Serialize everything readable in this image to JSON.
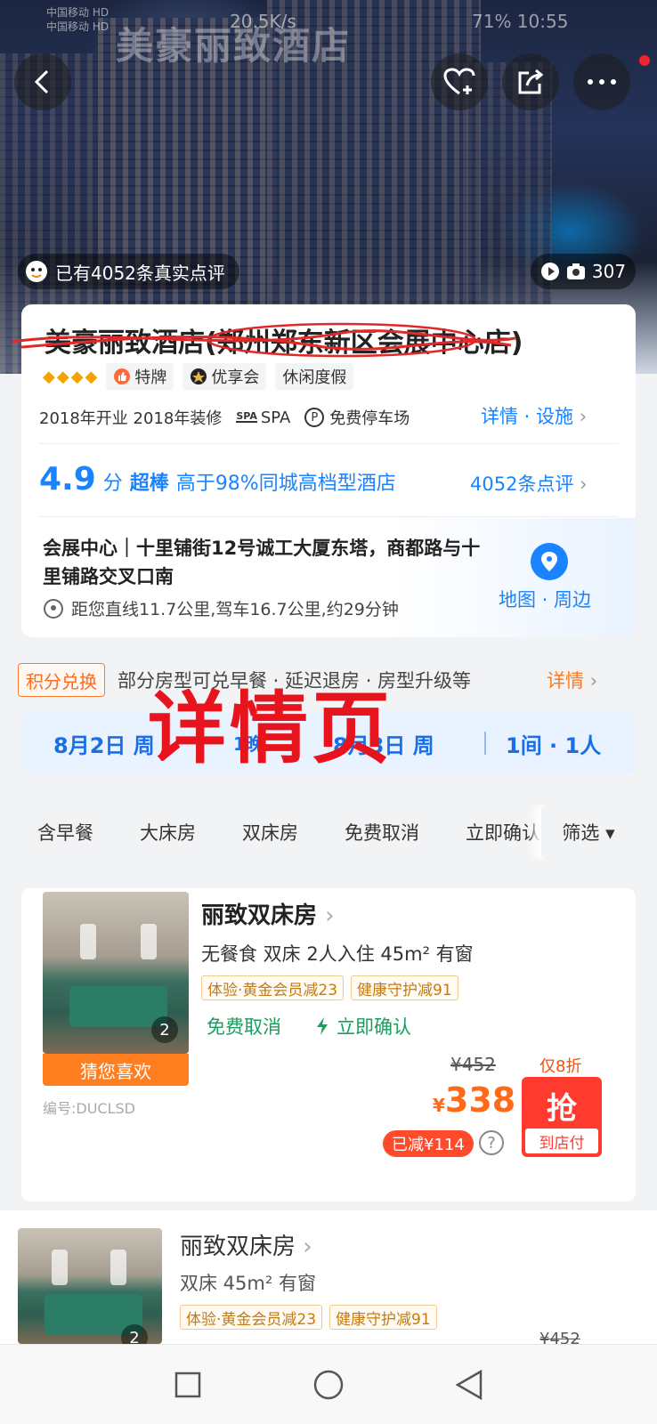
{
  "status_bar": {
    "carrier_1": "中国移动 HD",
    "carrier_2": "中国移动 HD",
    "net_speed": "20.5K/s",
    "battery_time": "71% 10:55"
  },
  "hero": {
    "signage": "美豪丽致酒店",
    "review_pill_text": "已有4052条真实点评",
    "photo_count": "307",
    "icons": [
      "back-icon",
      "favorite-add-icon",
      "share-icon",
      "more-icon"
    ]
  },
  "hotel": {
    "name": "美豪丽致酒店(郑州郑东新区会展中心店)",
    "tags": [
      "特牌",
      "优享会",
      "休闲度假"
    ],
    "facilities": [
      "2018年开业 2018年装修",
      "SPA",
      "免费停车场"
    ],
    "facility_icon_labels": [
      "SPA",
      "P"
    ],
    "detail_link": "详情 · 设施",
    "score": "4.9",
    "score_unit": "分",
    "score_level": "超棒",
    "score_compare": "高于98%同城高档型酒店",
    "reviews_link": "4052条点评",
    "address_line": "会展中心｜十里铺街12号诚工大厦东塔，商都路与十里铺路交叉口南",
    "distance": "距您直线11.7公里,驾车16.7公里,约29分钟",
    "map_link": "地图 · 周边"
  },
  "points": {
    "badge": "积分兑换",
    "text": "部分房型可兑早餐 · 延迟退房 · 房型升级等",
    "detail": "详情"
  },
  "dates": {
    "checkin": "8月2日 周",
    "nights": "1晚",
    "checkout": "8月3日 周",
    "rooms_guests": "1间 · 1人"
  },
  "watermark": "详情页",
  "filters": [
    "含早餐",
    "大床房",
    "双床房",
    "免费取消",
    "立即确认"
  ],
  "filter_button": "筛选 ▾",
  "rooms": [
    {
      "title": "丽致双床房",
      "meta": "无餐食   双床   2人入住   45m²   有窗",
      "chips": [
        "体验·黄金会员减23",
        "健康守护减91"
      ],
      "cancel": "免费取消",
      "confirm": "立即确认",
      "photo_count": "2",
      "guess": "猜您喜欢",
      "code": "编号:DUCLSD",
      "original_price": "¥452",
      "discount": "仅8折",
      "currency": "¥",
      "price": "338",
      "grab": "抢",
      "pay": "到店付",
      "saved": "已减¥114",
      "help": "?"
    },
    {
      "title": "丽致双床房",
      "meta": "双床 45m² 有窗",
      "chips": [
        "体验·黄金会员减23",
        "健康守护减91"
      ],
      "photo_count": "2",
      "original_price": "¥452"
    }
  ],
  "colors": {
    "accent_blue": "#1a83ff",
    "orange": "#ff6a1a",
    "red": "#ff3b2f",
    "green": "#17a05d"
  }
}
